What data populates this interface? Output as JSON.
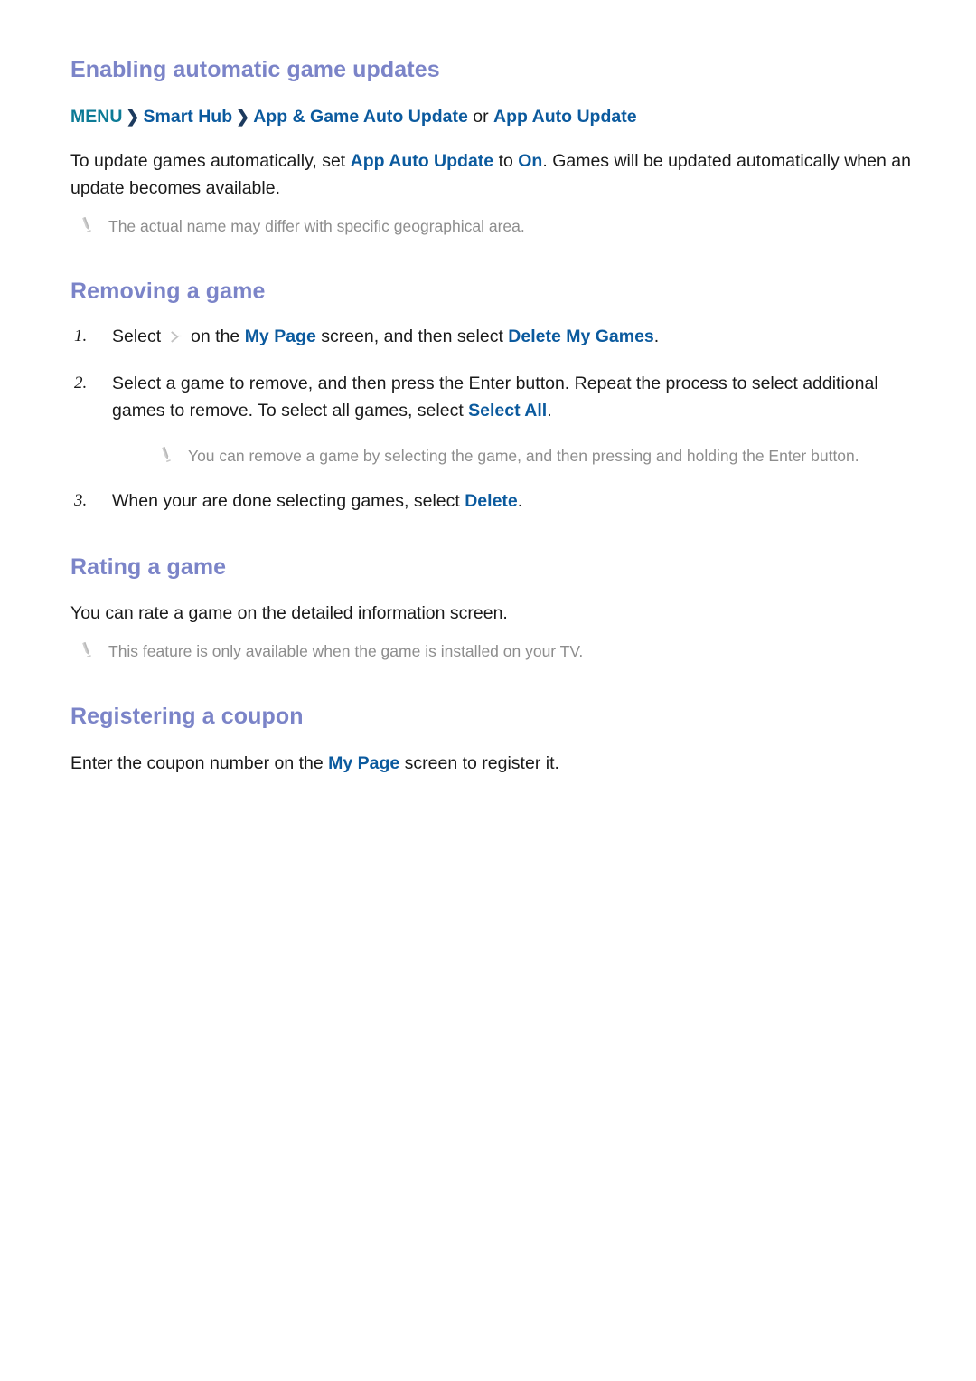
{
  "colors": {
    "heading": "#7b84c8",
    "link": "#0b5a9e",
    "menu_root": "#0d7b96",
    "body": "#1a1a1a",
    "note": "#8d8d8d",
    "chevron": "#1c3a5e",
    "icon_gray": "#b5b5b5"
  },
  "sections": [
    {
      "title": "Enabling automatic game updates",
      "menu_path": {
        "root": "MENU",
        "separator": "❯",
        "item2": "Smart Hub",
        "item3": "App & Game Auto Update",
        "conjunction": "or",
        "item4": "App Auto Update"
      },
      "paragraph": {
        "p1": "To update games automatically, set ",
        "link1": "App Auto Update",
        "p2": " to ",
        "link2": "On",
        "p3": ". Games will be updated automatically when an update becomes available."
      },
      "note": "The actual name may differ with specific geographical area."
    },
    {
      "title": "Removing a game",
      "steps": [
        {
          "num": "1.",
          "t1": "Select ",
          "icon": "chevron-right-icon",
          "t2": " on the ",
          "link1": "My Page",
          "t3": " screen, and then select ",
          "link2": "Delete My Games",
          "t4": "."
        },
        {
          "num": "2.",
          "t1": "Select a game to remove, and then press the Enter button. Repeat the process to select additional games to remove. To select all games, select ",
          "link1": "Select All",
          "t2": "."
        },
        {
          "num": "3.",
          "t1": "When your are done selecting games, select ",
          "link1": "Delete",
          "t2": "."
        }
      ],
      "note": "You can remove a game by selecting the game, and then pressing and holding the Enter button."
    },
    {
      "title": "Rating a game",
      "paragraph": {
        "full": "You can rate a game on the detailed information screen."
      },
      "note": "This feature is only available when the game is installed on your TV."
    },
    {
      "title": "Registering a coupon",
      "paragraph": {
        "p1": "Enter the coupon number on the ",
        "link1": "My Page",
        "p2": " screen to register it."
      }
    }
  ],
  "icons": {
    "note_icon_name": "pencil-note-icon",
    "chevron_icon_name": "chevron-right-icon"
  }
}
